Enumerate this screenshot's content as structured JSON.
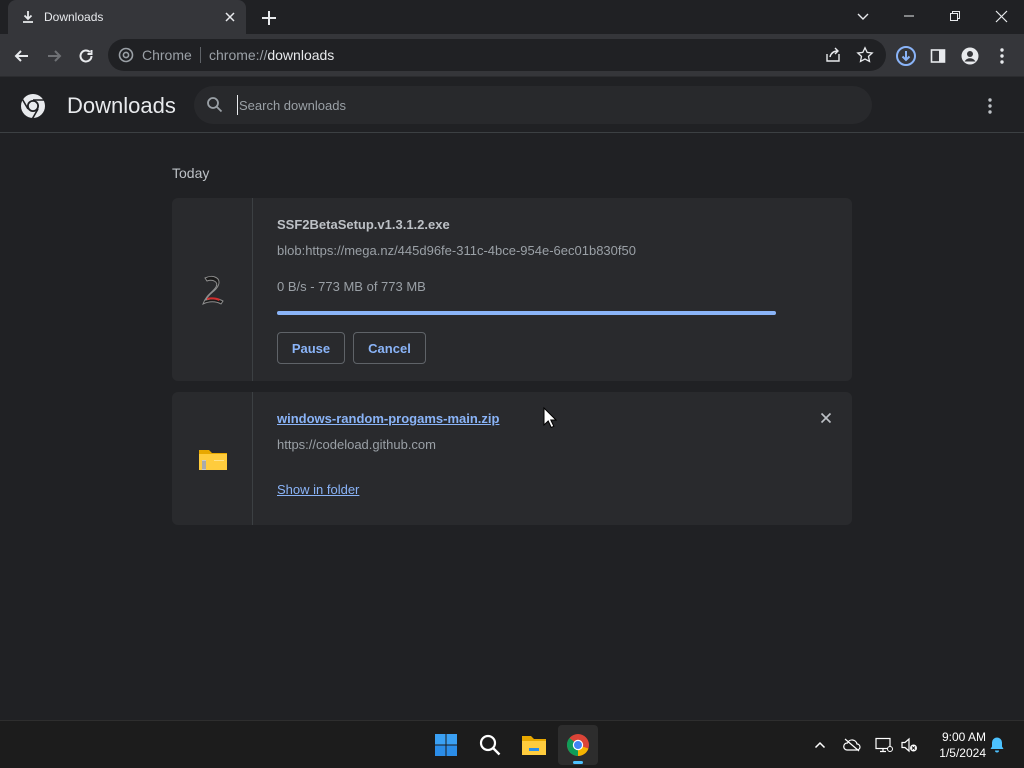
{
  "tab": {
    "title": "Downloads"
  },
  "omnibox": {
    "chip": "Chrome",
    "url_scheme": "chrome://",
    "url_host": "downloads"
  },
  "page": {
    "title": "Downloads",
    "search_placeholder": "Search downloads"
  },
  "date_header": "Today",
  "downloads": [
    {
      "filename": "SSF2BetaSetup.v1.3.1.2.exe",
      "source": "blob:https://mega.nz/445d96fe-311c-4bce-954e-6ec01b830f50",
      "status": "0 B/s - 773 MB of 773 MB",
      "progress_fraction": 1.0,
      "pause_label": "Pause",
      "cancel_label": "Cancel"
    },
    {
      "filename": "windows-random-progams-main.zip",
      "source": "https://codeload.github.com",
      "show_label": "Show in folder"
    }
  ],
  "taskbar": {
    "time": "9:00 AM",
    "date": "1/5/2024"
  },
  "colors": {
    "accent": "#8ab4f8",
    "background": "#202124",
    "card": "#292a2d",
    "toolbar": "#35363a"
  }
}
